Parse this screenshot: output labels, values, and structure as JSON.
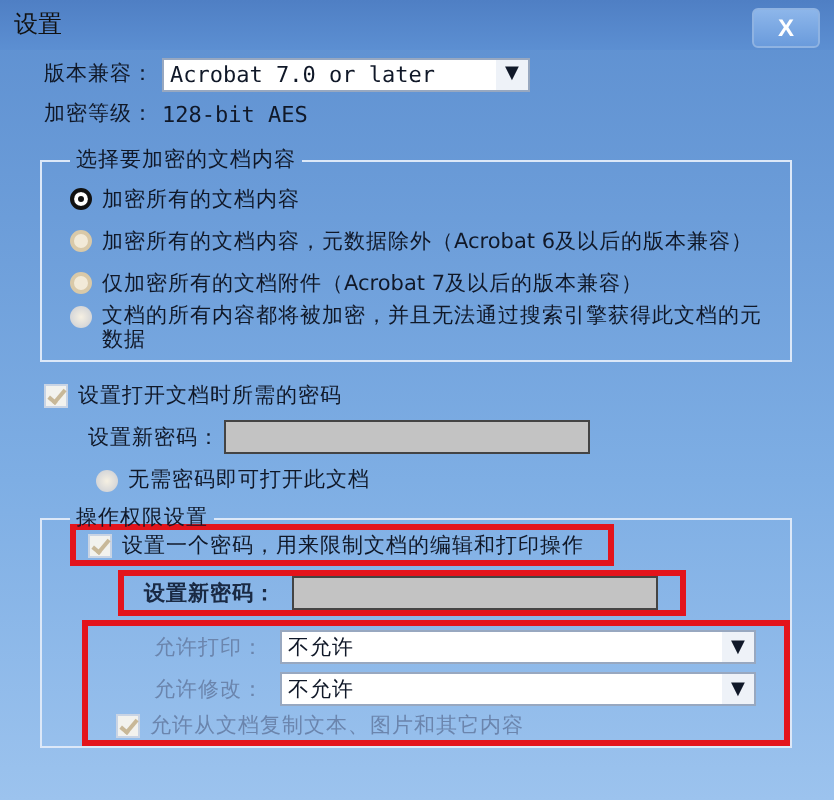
{
  "window": {
    "title": "设置",
    "close": "X"
  },
  "compat": {
    "label": "版本兼容：",
    "value": "Acrobat 7.0 or later",
    "caret": "▼"
  },
  "level": {
    "label": "加密等级：",
    "value": "128-bit AES"
  },
  "content_group": {
    "legend": "选择要加密的文档内容",
    "options": [
      {
        "label": "加密所有的文档内容",
        "selected": true
      },
      {
        "label": "加密所有的文档内容，元数据除外（Acrobat 6及以后的版本兼容）",
        "selected": false
      },
      {
        "label": "仅加密所有的文档附件（Acrobat 7及以后的版本兼容）",
        "selected": false
      }
    ],
    "note": "文档的所有内容都将被加密，并且无法通过搜索引擎获得此文档的元数据"
  },
  "open_password": {
    "label": "设置打开文档时所需的密码",
    "checked": true,
    "field_label": "设置新密码：",
    "note": "无需密码即可打开此文档"
  },
  "permissions": {
    "legend": "操作权限设置",
    "restrict": {
      "label": "设置一个密码，用来限制文档的编辑和打印操作",
      "checked": true,
      "highlighted": true
    },
    "password": {
      "label": "设置新密码：",
      "highlighted": true
    },
    "highlighted": true,
    "selects": [
      {
        "label": "允许打印：",
        "value": "不允许",
        "disabled": true,
        "caret": "▼"
      },
      {
        "label": "允许修改：",
        "value": "不允许",
        "disabled": true,
        "caret": "▼"
      }
    ],
    "copy": {
      "label": "允许从文档复制文本、图片和其它内容",
      "checked": true,
      "disabled": true
    }
  }
}
